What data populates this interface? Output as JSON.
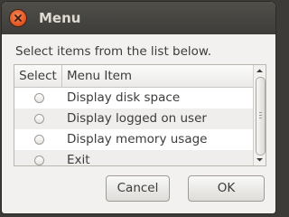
{
  "window": {
    "title": "Menu"
  },
  "prompt": "Select items from the list below.",
  "list": {
    "columns": [
      "Select",
      "Menu Item"
    ],
    "rows": [
      {
        "label": "Display disk space",
        "selected": false
      },
      {
        "label": "Display logged on user",
        "selected": false
      },
      {
        "label": "Display memory usage",
        "selected": false
      },
      {
        "label": "Exit",
        "selected": false
      }
    ]
  },
  "buttons": {
    "cancel": "Cancel",
    "ok": "OK"
  },
  "colors": {
    "titlebar": "#3e3d39",
    "close_button": "#e0511f",
    "window_bg": "#f2f1f0",
    "alt_row": "#efeeec"
  },
  "icons": {
    "close": "close-icon",
    "scroll_up": "chevron-up-icon",
    "scroll_down": "chevron-down-icon"
  }
}
